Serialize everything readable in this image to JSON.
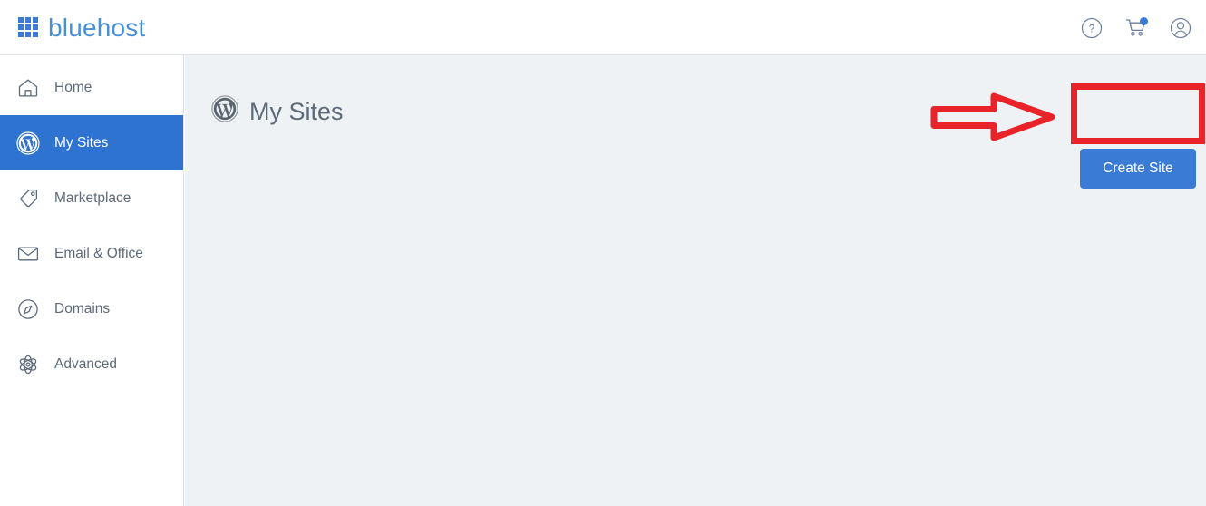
{
  "brand": {
    "name": "bluehost",
    "logo_icon": "grid-squares-icon",
    "logo_color": "#3a7bd5"
  },
  "topbar": {
    "actions": [
      {
        "name": "help-icon",
        "label": "Help",
        "glyph": "?"
      },
      {
        "name": "cart-icon",
        "label": "Cart",
        "badge": true
      },
      {
        "name": "account-icon",
        "label": "Account"
      }
    ]
  },
  "sidebar": {
    "items": [
      {
        "label": "Home",
        "icon": "home-icon",
        "active": false
      },
      {
        "label": "My Sites",
        "icon": "wordpress-icon",
        "active": true
      },
      {
        "label": "Marketplace",
        "icon": "tag-icon",
        "active": false
      },
      {
        "label": "Email & Office",
        "icon": "envelope-icon",
        "active": false
      },
      {
        "label": "Domains",
        "icon": "compass-icon",
        "active": false
      },
      {
        "label": "Advanced",
        "icon": "atom-icon",
        "active": false
      }
    ],
    "active_color": "#2f73d0"
  },
  "main": {
    "page_title": "My Sites",
    "page_title_icon": "wordpress-icon",
    "create_site_label": "Create Site",
    "create_site_color": "#3a7bd5",
    "background_color": "#eef2f5"
  },
  "annotations": {
    "color": "#e8232a",
    "arrow": {
      "name": "red-arrow-right",
      "direction": "right"
    },
    "highlight_box": {
      "name": "red-highlight-box",
      "targets": "create-site-button"
    }
  }
}
